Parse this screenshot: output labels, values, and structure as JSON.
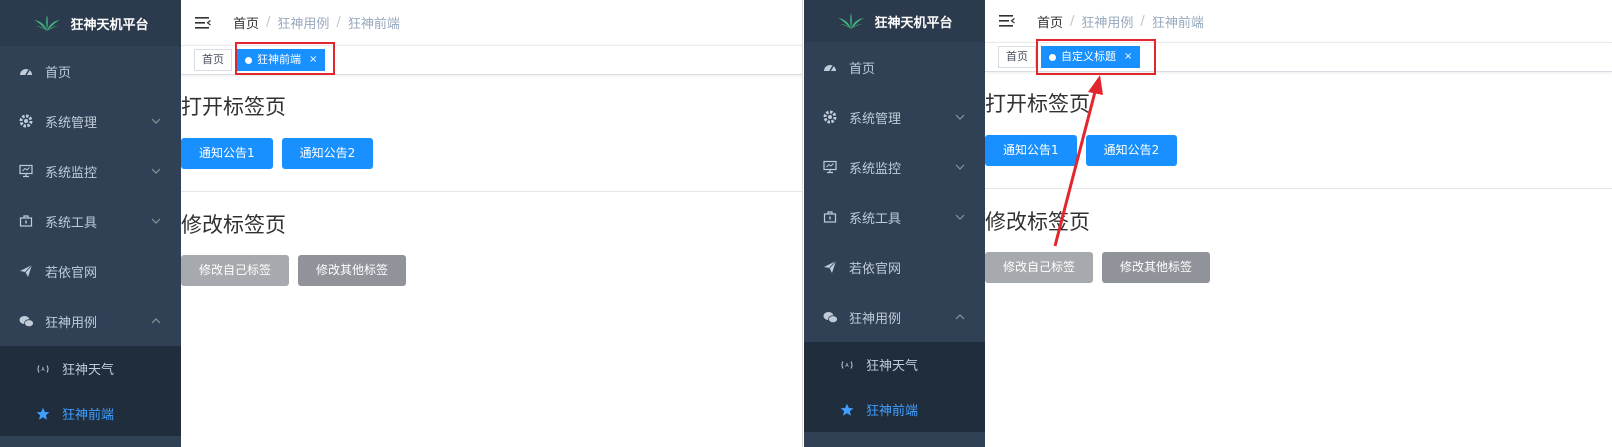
{
  "panels": [
    {
      "sidebar": {
        "title": "狂神天机平台",
        "menu": [
          {
            "label": "首页",
            "icon": "dashboard-icon"
          },
          {
            "label": "系统管理",
            "icon": "gear-icon"
          },
          {
            "label": "系统监控",
            "icon": "monitor-icon"
          },
          {
            "label": "系统工具",
            "icon": "toolbox-icon"
          },
          {
            "label": "若依官网",
            "icon": "paper-plane-icon"
          },
          {
            "label": "狂神用例",
            "icon": "wechat-icon"
          }
        ],
        "submenu": [
          {
            "label": "狂神天气",
            "icon": "radio-icon"
          },
          {
            "label": "狂神前端",
            "icon": "star-icon"
          }
        ]
      },
      "breadcrumb": {
        "home": "首页",
        "parent": "狂神用例",
        "current": "狂神前端"
      },
      "tags": {
        "home": "首页",
        "active": "狂神前端",
        "close": "×"
      },
      "sections": {
        "open_title": "打开标签页",
        "open_buttons": [
          "通知公告1",
          "通知公告2"
        ],
        "modify_title": "修改标签页",
        "modify_buttons": [
          "修改自己标签",
          "修改其他标签"
        ]
      }
    },
    {
      "sidebar": {
        "title": "狂神天机平台",
        "menu": [
          {
            "label": "首页",
            "icon": "dashboard-icon"
          },
          {
            "label": "系统管理",
            "icon": "gear-icon"
          },
          {
            "label": "系统监控",
            "icon": "monitor-icon"
          },
          {
            "label": "系统工具",
            "icon": "toolbox-icon"
          },
          {
            "label": "若依官网",
            "icon": "paper-plane-icon"
          },
          {
            "label": "狂神用例",
            "icon": "wechat-icon"
          }
        ],
        "submenu": [
          {
            "label": "狂神天气",
            "icon": "radio-icon"
          },
          {
            "label": "狂神前端",
            "icon": "star-icon"
          }
        ]
      },
      "breadcrumb": {
        "home": "首页",
        "parent": "狂神用例",
        "current": "狂神前端"
      },
      "tags": {
        "home": "首页",
        "active": "自定义标题",
        "close": "×"
      },
      "sections": {
        "open_title": "打开标签页",
        "open_buttons": [
          "通知公告1",
          "通知公告2"
        ],
        "modify_title": "修改标签页",
        "modify_buttons": [
          "修改自己标签",
          "修改其他标签"
        ]
      }
    }
  ],
  "colors": {
    "sidebar_bg": "#304156",
    "submenu_bg": "#1f2d3d",
    "primary": "#1890ff",
    "info": "#909399",
    "annotation": "#e3262d"
  }
}
